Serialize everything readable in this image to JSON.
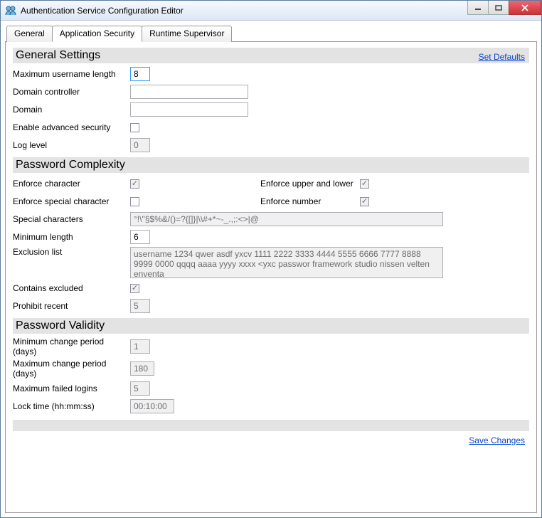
{
  "window": {
    "title": "Authentication Service Configuration Editor"
  },
  "tabs": [
    {
      "label": "General"
    },
    {
      "label": "Application Security"
    },
    {
      "label": "Runtime Supervisor"
    }
  ],
  "activeTabIndex": 1,
  "links": {
    "setDefaults": "Set Defaults",
    "saveChanges": "Save Changes"
  },
  "sections": {
    "general": {
      "title": "General Settings",
      "maxUsernameLabel": "Maximum username length",
      "maxUsernameValue": "8",
      "domainControllerLabel": "Domain controller",
      "domainControllerValue": "",
      "domainLabel": "Domain",
      "domainValue": "",
      "enableAdvancedLabel": "Enable advanced security",
      "enableAdvancedChecked": false,
      "logLevelLabel": "Log level",
      "logLevelValue": "0"
    },
    "complexity": {
      "title": "Password Complexity",
      "enforceCharLabel": "Enforce character",
      "enforceCharChecked": true,
      "enforceUpperLowerLabel": "Enforce upper and lower",
      "enforceUpperLowerChecked": true,
      "enforceSpecialLabel": "Enforce special character",
      "enforceSpecialChecked": false,
      "enforceNumberLabel": "Enforce number",
      "enforceNumberChecked": true,
      "specialCharsLabel": "Special characters",
      "specialCharsValue": "°!\\\"§$%&/()=?{[]}|\\\\#+*~-_.,;:<>|@",
      "minLengthLabel": "Minimum length",
      "minLengthValue": "6",
      "exclusionLabel": "Exclusion list",
      "exclusionValue": "username 1234 qwer asdf yxcv 1111 2222 3333 4444 5555 6666 7777 8888 9999 0000 qqqq aaaa yyyy xxxx <yxc passwor framework studio nissen velten enventa",
      "containsExcludedLabel": "Contains excluded",
      "containsExcludedChecked": true,
      "prohibitRecentLabel": "Prohibit recent",
      "prohibitRecentValue": "5"
    },
    "validity": {
      "title": "Password Validity",
      "minChangeLabel": "Minimum change period (days)",
      "minChangeValue": "1",
      "maxChangeLabel": "Maximum change period (days)",
      "maxChangeValue": "180",
      "maxFailedLabel": "Maximum failed logins",
      "maxFailedValue": "5",
      "lockTimeLabel": "Lock time (hh:mm:ss)",
      "lockTimeValue": "00:10:00"
    }
  }
}
